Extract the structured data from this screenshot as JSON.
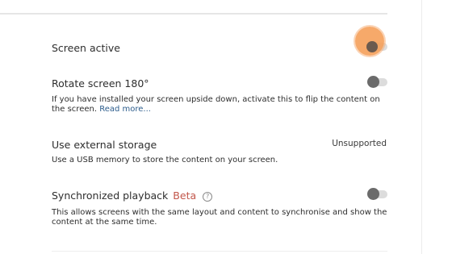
{
  "settings": [
    {
      "title": "Screen active",
      "state": "off",
      "pressed": true
    },
    {
      "title": "Rotate screen 180°",
      "description": "If you have installed your screen upside down, activate this to flip the content on the screen.",
      "link_label": "Read more...",
      "state": "off"
    },
    {
      "title": "Use external storage",
      "description": "Use a USB memory to store the content on your screen.",
      "status": "Unsupported"
    },
    {
      "title": "Synchronized playback",
      "badge": "Beta",
      "help_glyph": "?",
      "description": "This allows screens with the same layout and content to synchronise and show the content at the same time.",
      "state": "off"
    }
  ],
  "colors": {
    "accent_press": "#f5a05a",
    "link": "#2d5d8c",
    "beta": "#c2564a",
    "toggle_knob": "#6b6b6b",
    "toggle_track": "#dcdcdc"
  }
}
